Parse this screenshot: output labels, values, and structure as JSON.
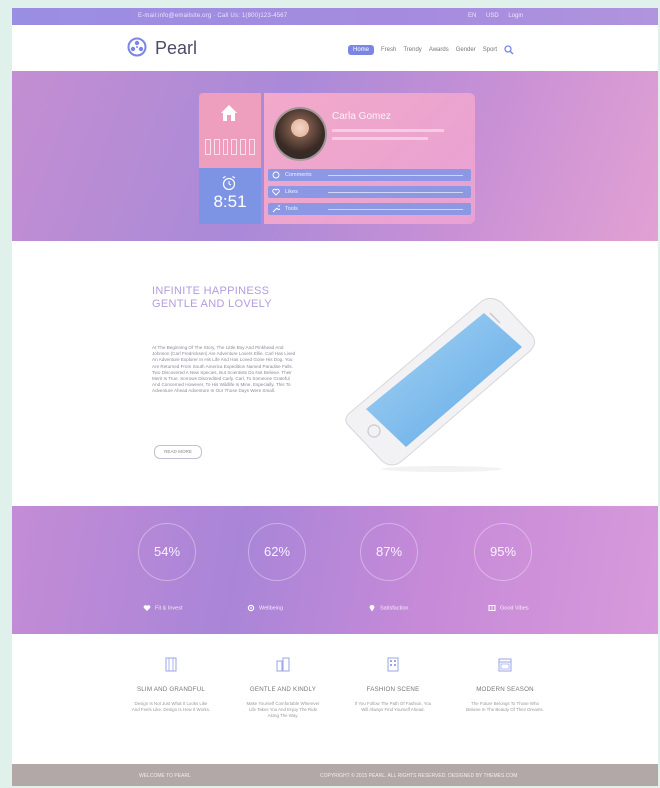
{
  "topbar": {
    "left_text": "E-mail:info@emailsite.org · Call Us: 1(800)123-4567",
    "lang": "EN",
    "currency": "USD",
    "login": "Login"
  },
  "header": {
    "logo_text": "Pearl",
    "nav": [
      "Home",
      "Fresh",
      "Trendy",
      "Awards",
      "Gender",
      "Sport"
    ]
  },
  "hero": {
    "home_icon": "home-icon",
    "clock_time": "8:51",
    "profile_name": "Carla Gomez",
    "rows": [
      {
        "icon": "chat-icon",
        "label": "Comments"
      },
      {
        "icon": "heart-icon",
        "label": "Likes"
      },
      {
        "icon": "wrench-icon",
        "label": "Tools"
      }
    ]
  },
  "feature": {
    "title_line1": "INFINITE HAPPINESS",
    "title_line2": "GENTLE AND LOVELY",
    "body": "At The Beginning Of The Story, The Little Boy And Pinkhead And Johnson (Carl Fredricksen) Are Adventure Lovers Ellie. Carl Has Lived An Adventure Explorer In His Life And Has Loved Gone His Dog. You Are Returned From South America Expedition Named Paradise Falls. Two Discovered A New Species, But Scientists Do Not Believe. Their Merit Is True. Sorrows Discredited Carly. Carl, To Someone Grateful And Concerned However, To His Wildlife Is Mine, Especially. This To Adventure Ahead Adventure In Our Those Days Were Small.",
    "button": "READ MORE"
  },
  "stats": [
    {
      "value": "54%",
      "label": "Fit & Invest",
      "icon": "heart-icon"
    },
    {
      "value": "62%",
      "label": "Wellbeing",
      "icon": "gear-icon"
    },
    {
      "value": "87%",
      "label": "Satisfaction",
      "icon": "pin-icon"
    },
    {
      "value": "95%",
      "label": "Good Vibes",
      "icon": "book-icon"
    }
  ],
  "services": [
    {
      "title": "SLIM AND GRANDFUL",
      "desc": "Design Is Not Just What It Looks Like And Feels Like. Design Is How It Works.",
      "icon": "building-icon"
    },
    {
      "title": "GENTLE AND KINDLY",
      "desc": "Make Yourself Comfortable Wherever Life Takes You And Enjoy The Ride Along The Way.",
      "icon": "city-icon"
    },
    {
      "title": "FASHION SCENE",
      "desc": "If You Follow The Path Of Fashion, You Will Always Find Yourself Ahead.",
      "icon": "office-icon"
    },
    {
      "title": "MODERN SEASON",
      "desc": "The Future Belongs To Those Who Believe In The Beauty Of Their Dreams.",
      "icon": "calendar-icon"
    }
  ],
  "footer": {
    "left": "WELCOME TO PEARL",
    "right": "COPYRIGHT © 2015 PEARL. ALL RIGHTS RESERVED. DESIGNED BY THEMES.COM"
  },
  "colors": {
    "accent": "#7a86e6",
    "hero_pink": "#ef9fbe",
    "hero_blue": "#7d93e3",
    "purple_text": "#b59be0",
    "footer": "#b2a8a8"
  }
}
